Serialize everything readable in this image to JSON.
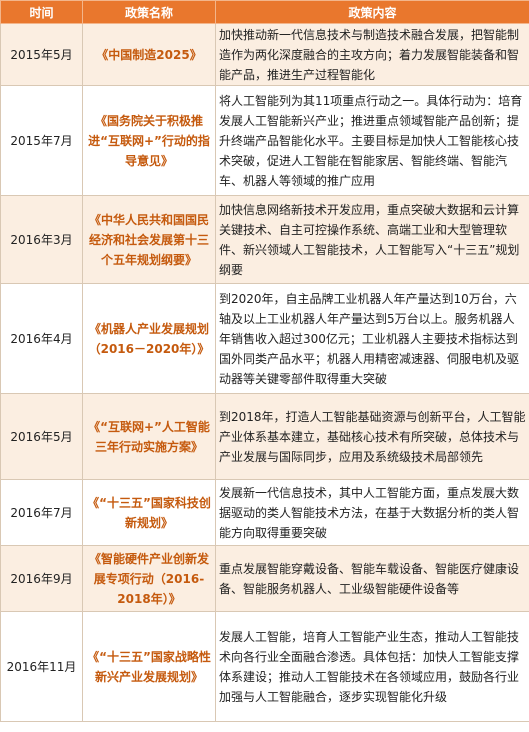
{
  "header": {
    "time": "时间",
    "name": "政策名称",
    "content": "政策内容"
  },
  "rows": [
    {
      "time": "2015年5月",
      "name": "《中国制造2025》",
      "content": "加快推动新一代信息技术与制造技术融合发展，把智能制造作为两化深度融合的主攻方向；着力发展智能装备和智能产品，推进生产过程智能化"
    },
    {
      "time": "2015年7月",
      "name": "《国务院关于积极推进“互联网+”行动的指导意见》",
      "content": "将人工智能列为其11项重点行动之一。具体行动为：培育发展人工智能新兴产业；推进重点领域智能产品创新；提升终端产品智能化水平。主要目标是加快人工智能核心技术突破，促进人工智能在智能家居、智能终端、智能汽车、机器人等领域的推广应用"
    },
    {
      "time": "2016年3月",
      "name": "《中华人民共和国国民经济和社会发展第十三个五年规划纲要》",
      "content": "加快信息网络新技术开发应用，重点突破大数据和云计算关键技术、自主可控操作系统、高端工业和大型管理软件、新兴领域人工智能技术，人工智能写入“十三五”规划纲要"
    },
    {
      "time": "2016年4月",
      "name": "《机器人产业发展规划（2016－2020年）》",
      "content": "到2020年，自主品牌工业机器人年产量达到10万台，六轴及以上工业机器人年产量达到5万台以上。服务机器人年销售收入超过300亿元；工业机器人主要技术指标达到国外同类产品水平；机器人用精密减速器、伺服电机及驱动器等关键零部件取得重大突破"
    },
    {
      "time": "2016年5月",
      "name": "《“互联网+”人工智能三年行动实施方案》",
      "content": "到2018年，打造人工智能基础资源与创新平台，人工智能产业体系基本建立，基础核心技术有所突破，总体技术与产业发展与国际同步，应用及系统级技术局部领先"
    },
    {
      "time": "2016年7月",
      "name": "《“十三五”国家科技创新规划》",
      "content": "发展新一代信息技术，其中人工智能方面，重点发展大数据驱动的类人智能技术方法，在基于大数据分析的类人智能方向取得重要突破"
    },
    {
      "time": "2016年9月",
      "name": "《智能硬件产业创新发展专项行动（2016-2018年）》",
      "content": "重点发展智能穿戴设备、智能车载设备、智能医疗健康设备、智能服务机器人、工业级智能硬件设备等"
    },
    {
      "time": "2016年11月",
      "name": "《“十三五”国家战略性新兴产业发展规划》",
      "content": "发展人工智能，培育人工智能产业生态，推动人工智能技术向各行业全面融合渗透。具体包括：加快人工智能支撑体系建设；推动人工智能技术在各领域应用，鼓励各行业加强与人工智能融合，逐步实现智能化升级"
    }
  ]
}
